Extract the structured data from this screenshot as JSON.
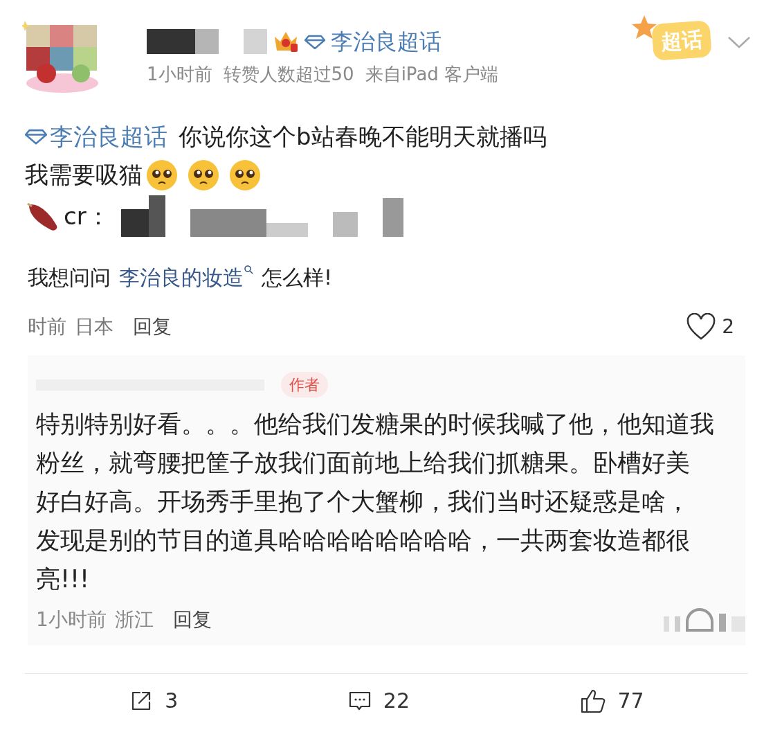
{
  "post": {
    "topic": "李治良超话",
    "meta": [
      "1小时前",
      "转赞人数超过50",
      "来自iPad 客户端"
    ],
    "badge": "超话",
    "topic_tag": "李治良超话",
    "lines": [
      "你说你这个b站春晚不能明天就播吗",
      "我需要吸猫"
    ],
    "credit": "cr："
  },
  "screenshot": {
    "comment": {
      "before": "我想问问",
      "link": "李治良的妆造",
      "after": "怎么样!",
      "time": "时前",
      "location": "日本",
      "reply": "回复",
      "likes": "2"
    },
    "reply": {
      "badge": "作者",
      "lines": [
        "特别特别好看。。。他给我们发糖果的时候我喊了他，他知道我",
        "粉丝，就弯腰把筐子放我们面前地上给我们抓糖果。卧槽好美",
        "好白好高。开场秀手里抱了个大蟹柳，我们当时还疑惑是啥，",
        "发现是别的节目的道具哈哈哈哈哈哈哈哈，一共两套妆造都很",
        "亮!!!"
      ],
      "time": "1小时前",
      "location": "浙江",
      "reply": "回复"
    }
  },
  "actions": [
    {
      "kind": "share",
      "count": "3"
    },
    {
      "kind": "comment",
      "count": "22"
    },
    {
      "kind": "like",
      "count": "77"
    }
  ]
}
